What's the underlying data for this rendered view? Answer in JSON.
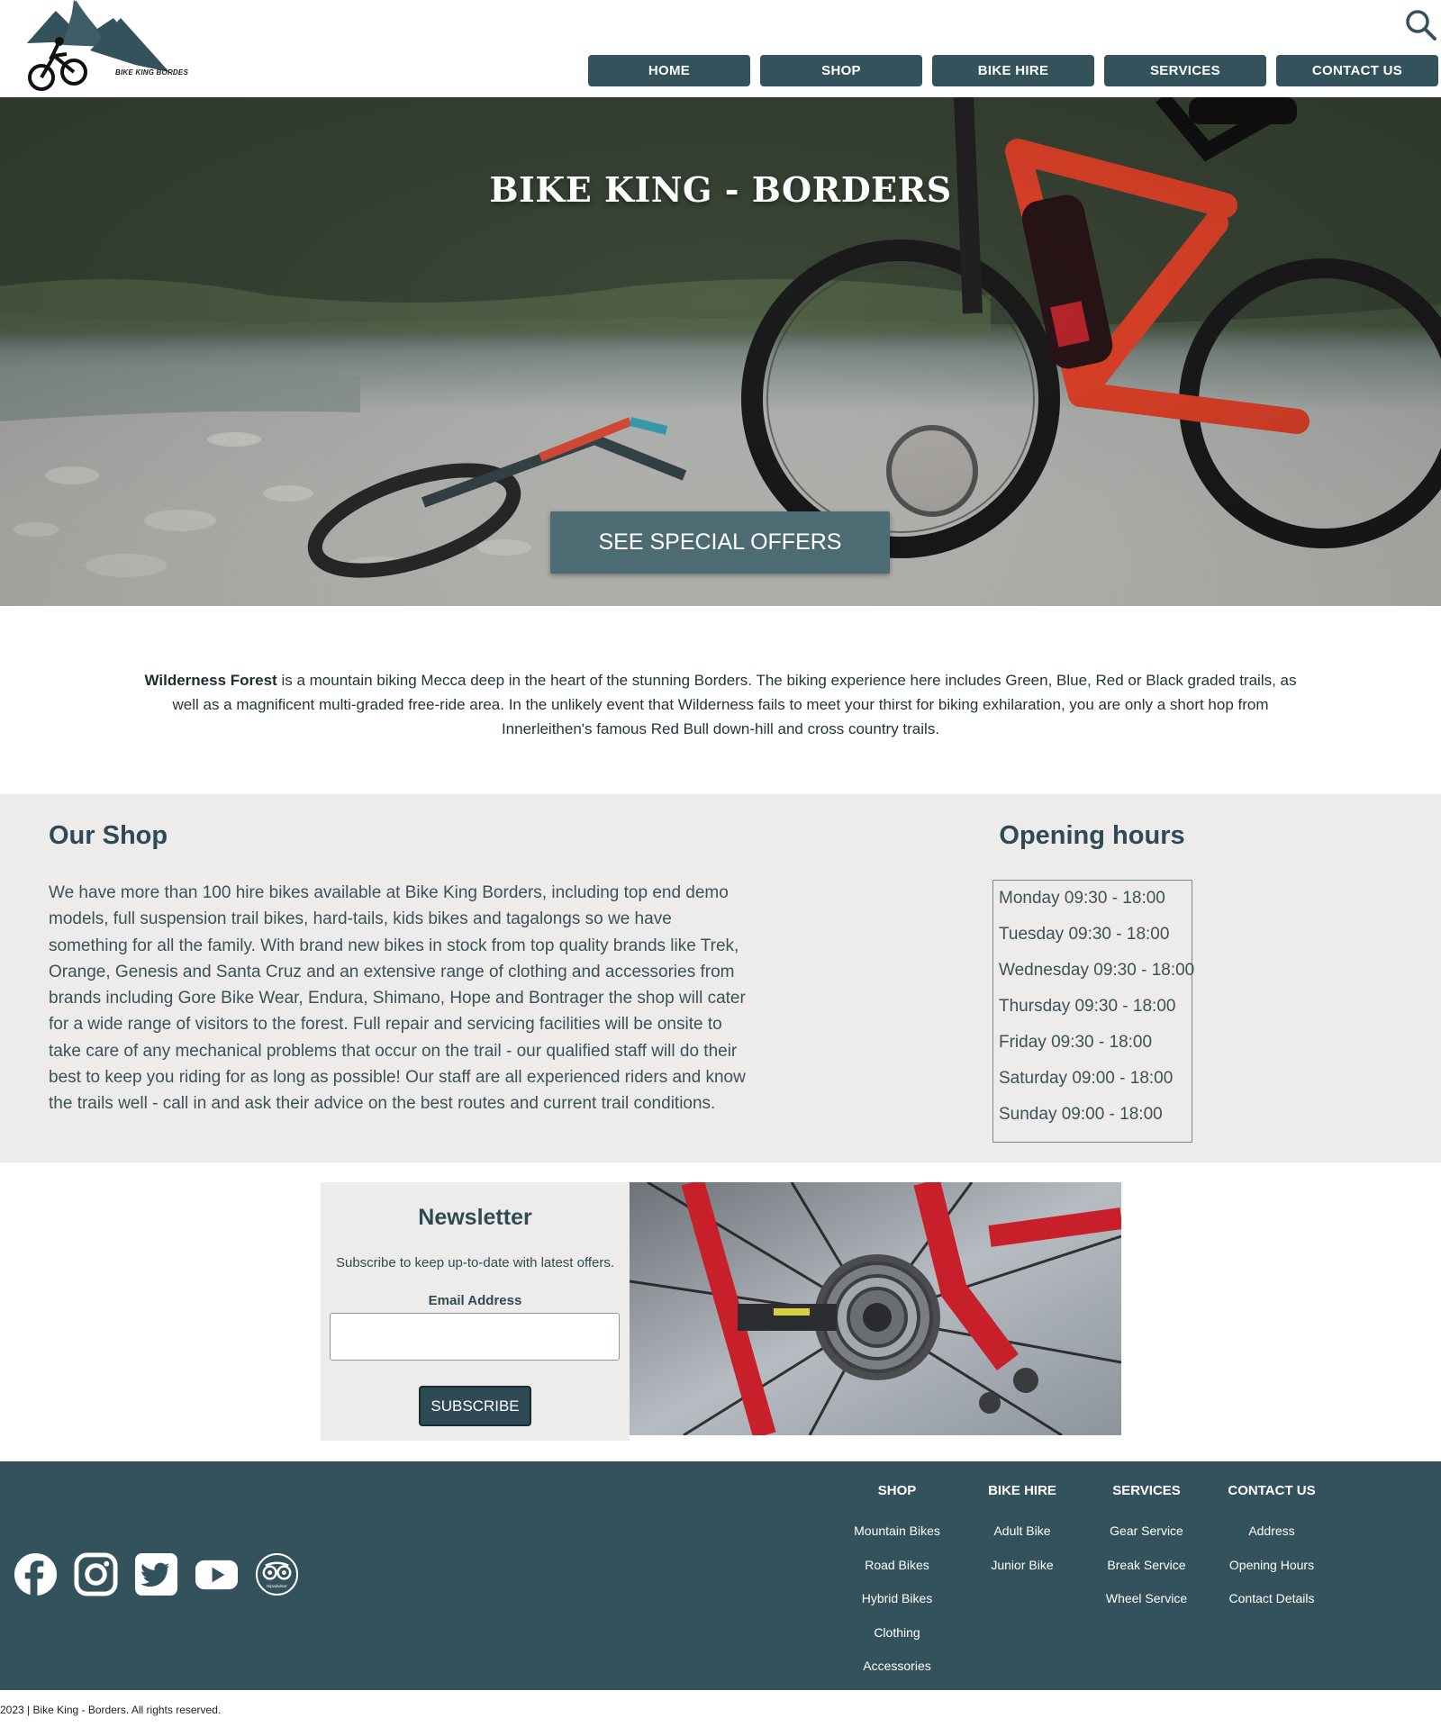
{
  "brand": {
    "logo_text": "BIKE KING BORDES"
  },
  "nav": {
    "items": [
      {
        "label": "HOME"
      },
      {
        "label": "SHOP"
      },
      {
        "label": "BIKE HIRE"
      },
      {
        "label": "SERVICES"
      },
      {
        "label": "CONTACT US"
      }
    ]
  },
  "hero": {
    "title": "BIKE KING - BORDERS",
    "cta_label": "SEE SPECIAL OFFERS"
  },
  "intro": {
    "highlight": "Wilderness Forest",
    "body": " is a mountain biking Mecca deep in the heart of the stunning Borders. The biking experience here includes Green, Blue, Red or Black graded trails, as well as a magnificent multi-graded free-ride area. In the unlikely event that Wilderness fails to meet your thirst for biking exhilaration, you are only a short hop from Innerleithen's famous Red Bull down-hill and cross country trails."
  },
  "shop": {
    "title": "Our Shop",
    "body": "We have more than 100 hire bikes available at Bike King Borders, including top end demo models, full suspension trail bikes, hard-tails, kids bikes and tagalongs so we have something for all the family. With brand new bikes in stock from top quality brands like Trek, Orange, Genesis and Santa Cruz and an extensive range of clothing and accessories from brands including Gore Bike Wear, Endura, Shimano, Hope and Bontrager the shop will cater for a wide range of visitors to the forest. Full repair and servicing facilities will be onsite to take care of any mechanical problems that occur on the trail - our qualified staff will do their best to keep you riding for as long as possible! Our staff are all experienced riders and know the trails well - call in and ask their advice on the best routes and current trail conditions."
  },
  "hours": {
    "title": "Opening hours",
    "rows": [
      "Monday 09:30 - 18:00",
      "Tuesday 09:30 - 18:00",
      "Wednesday 09:30 - 18:00",
      "Thursday 09:30 - 18:00",
      "Friday 09:30 - 18:00",
      "Saturday 09:00 - 18:00",
      "Sunday 09:00 - 18:00"
    ]
  },
  "newsletter": {
    "title": "Newsletter",
    "subtitle": "Subscribe to keep up-to-date with latest offers.",
    "email_label": "Email Address",
    "email_value": "",
    "email_placeholder": "",
    "button_label": "SUBSCRIBE"
  },
  "footer": {
    "social": [
      "facebook-icon",
      "instagram-icon",
      "twitter-icon",
      "youtube-icon",
      "tripadvisor-icon"
    ],
    "tripadvisor_text": "tripadvisor",
    "columns": [
      {
        "title": "SHOP",
        "links": [
          "Mountain Bikes",
          "Road Bikes",
          "Hybrid Bikes",
          "Clothing",
          "Accessories"
        ]
      },
      {
        "title": "BIKE HIRE",
        "links": [
          "Adult Bike",
          "Junior Bike"
        ]
      },
      {
        "title": "SERVICES",
        "links": [
          "Gear Service",
          "Break Service",
          "Wheel Service"
        ]
      },
      {
        "title": "CONTACT US",
        "links": [
          "Address",
          "Opening Hours",
          "Contact Details"
        ]
      }
    ],
    "copyright": "2023 | Bike King - Borders. All rights reserved."
  },
  "colors": {
    "primary": "#33525b",
    "panel": "#edecea",
    "text": "#2e4a54",
    "hero_cta": "#4d6b72",
    "bike_accent": "#e8442a"
  }
}
